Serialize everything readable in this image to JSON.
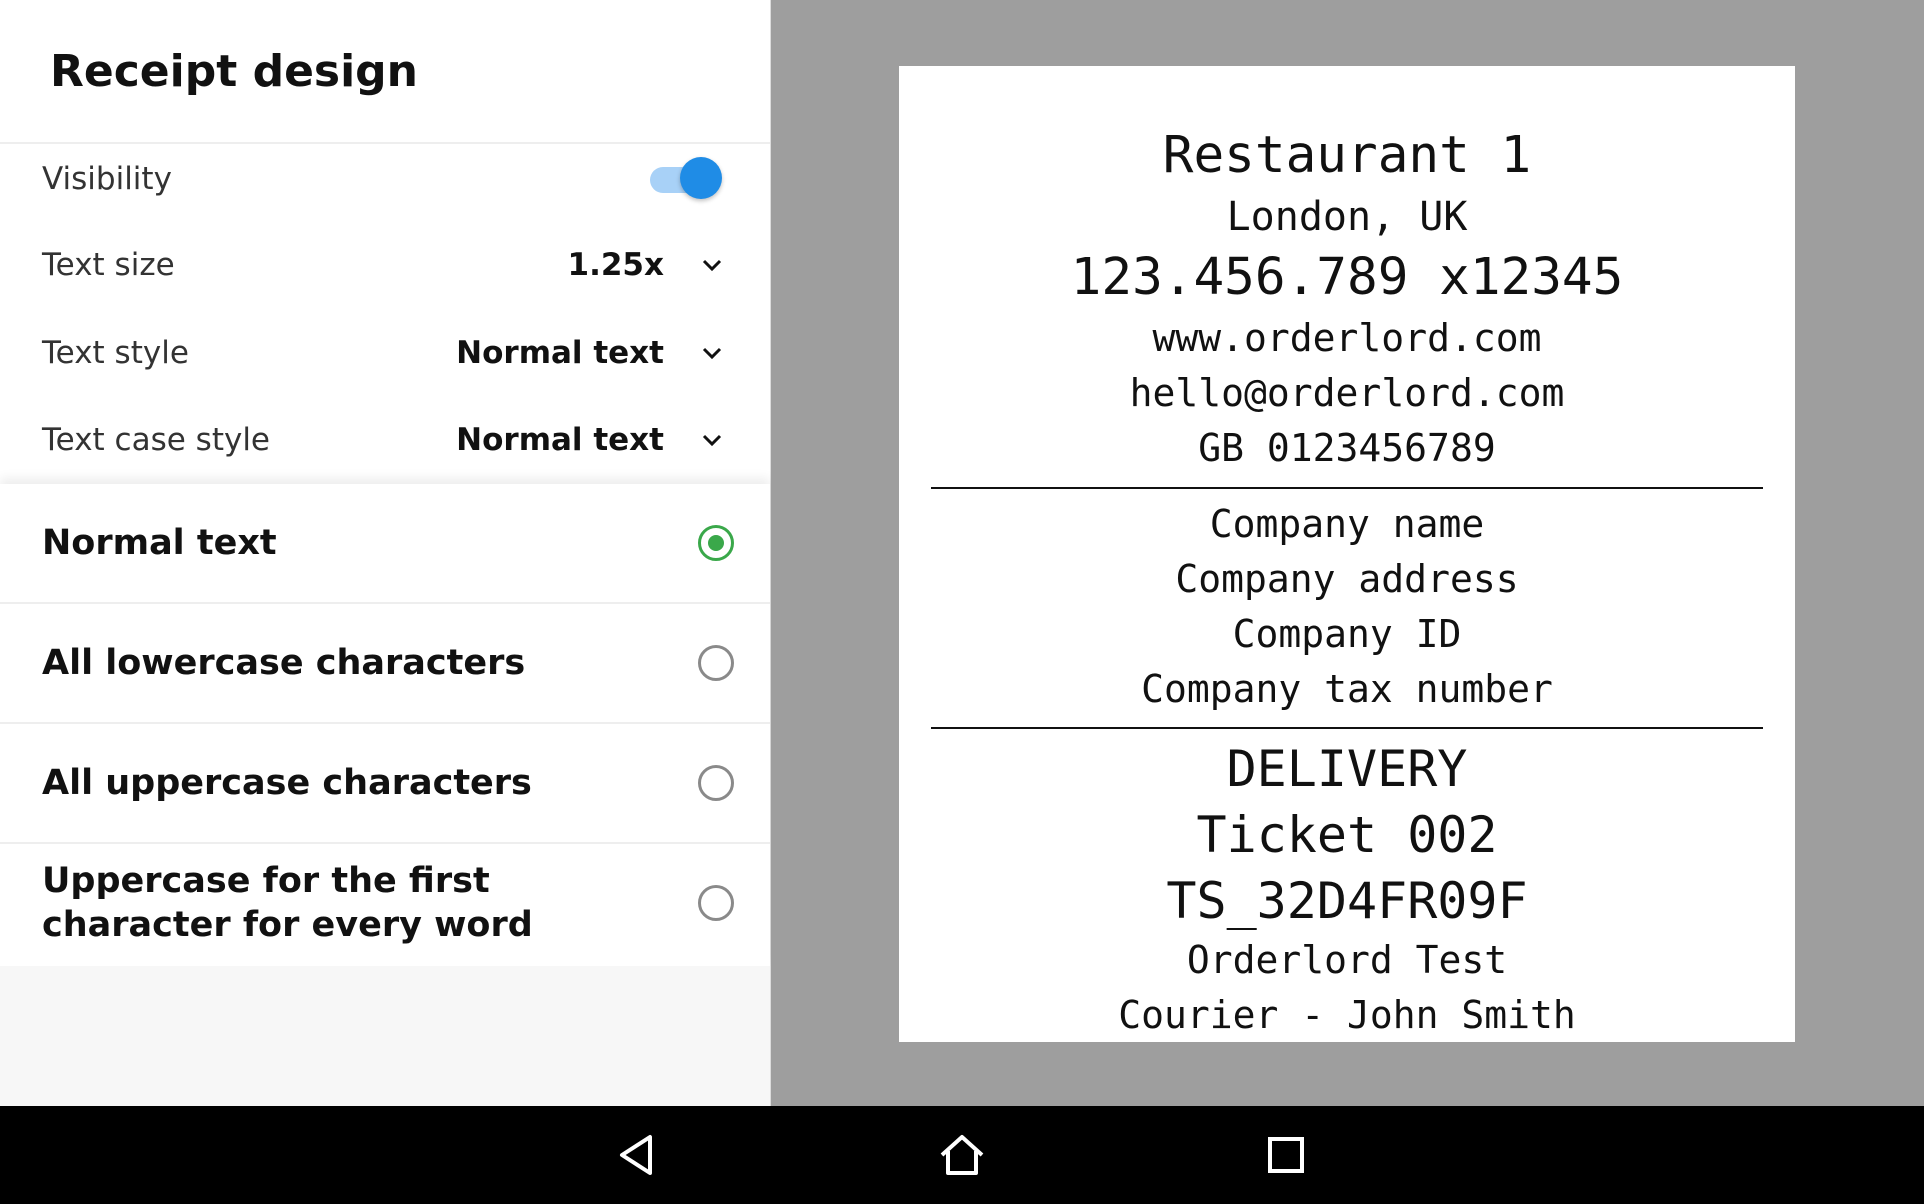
{
  "panel": {
    "title": "Receipt design",
    "settings": {
      "visibility": {
        "label": "Visibility",
        "enabled": true
      },
      "text_size": {
        "label": "Text size",
        "value": "1.25x"
      },
      "text_style": {
        "label": "Text style",
        "value": "Normal text"
      },
      "text_case_style": {
        "label": "Text case style",
        "value": "Normal text"
      }
    },
    "case_options": [
      {
        "label": "Normal text",
        "selected": true
      },
      {
        "label": "All lowercase characters",
        "selected": false
      },
      {
        "label": "All uppercase characters",
        "selected": false
      },
      {
        "label": "Uppercase for the first character for every word",
        "selected": false
      }
    ]
  },
  "receipt": {
    "header": {
      "restaurant": "Restaurant 1",
      "location": "London, UK",
      "phone": "123.456.789 x12345",
      "website": "www.orderlord.com",
      "email": "hello@orderlord.com",
      "vat": "GB 0123456789"
    },
    "company": {
      "name": "Company name",
      "address": "Company address",
      "id": "Company ID",
      "tax_number": "Company tax number"
    },
    "order": {
      "type": "DELIVERY",
      "ticket": "Ticket 002",
      "code": "TS_32D4FR09F",
      "customer": "Orderlord Test",
      "courier": "Courier - John Smith"
    }
  },
  "colors": {
    "toggle_on": "#1f8ce6",
    "radio_selected": "#3aa84a",
    "preview_bg": "#9e9e9e",
    "nav_bg": "#000000"
  },
  "nav": {
    "icons": [
      "back-icon",
      "home-icon",
      "recents-icon"
    ]
  }
}
